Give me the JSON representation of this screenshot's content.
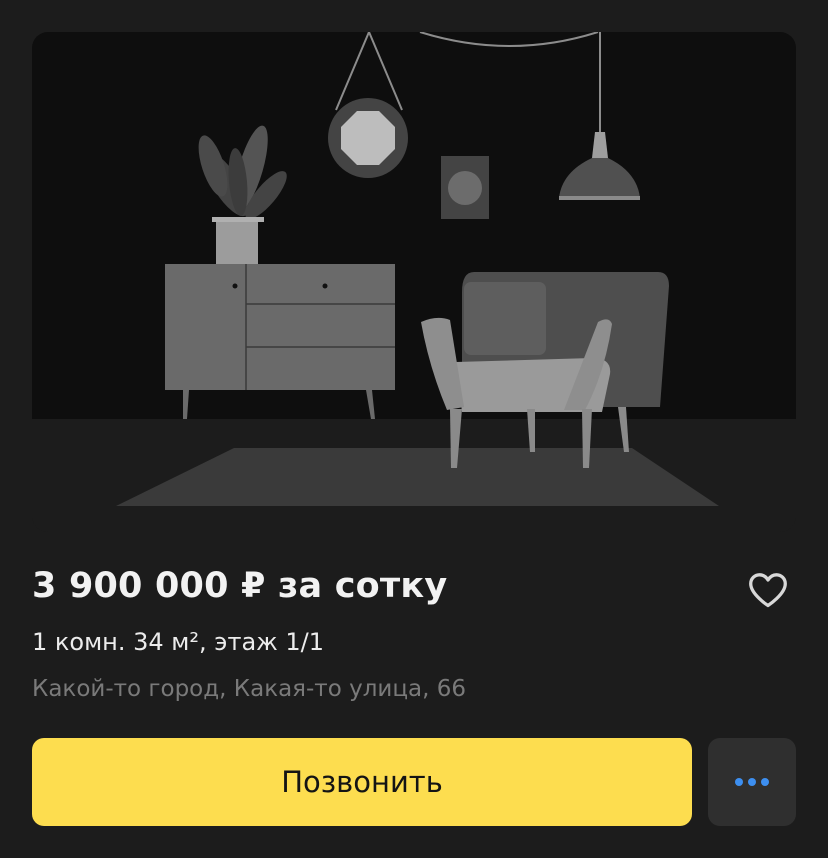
{
  "listing": {
    "price": "3 900 000 ₽ за сотку",
    "details": "1 комн. 34 м², этаж 1/1",
    "address": "Какой-то город, Какая-то улица, 66"
  },
  "actions": {
    "call_label": "Позвонить"
  },
  "icons": {
    "favorite": "heart-outline-icon",
    "more": "more-horizontal-icon"
  },
  "colors": {
    "background": "#1c1c1c",
    "call_button": "#fddd4f",
    "more_button": "#2f2f2f",
    "more_dots": "#3d8ff0",
    "heart": "#d8d8d8",
    "address_text": "#7a7a7a"
  }
}
